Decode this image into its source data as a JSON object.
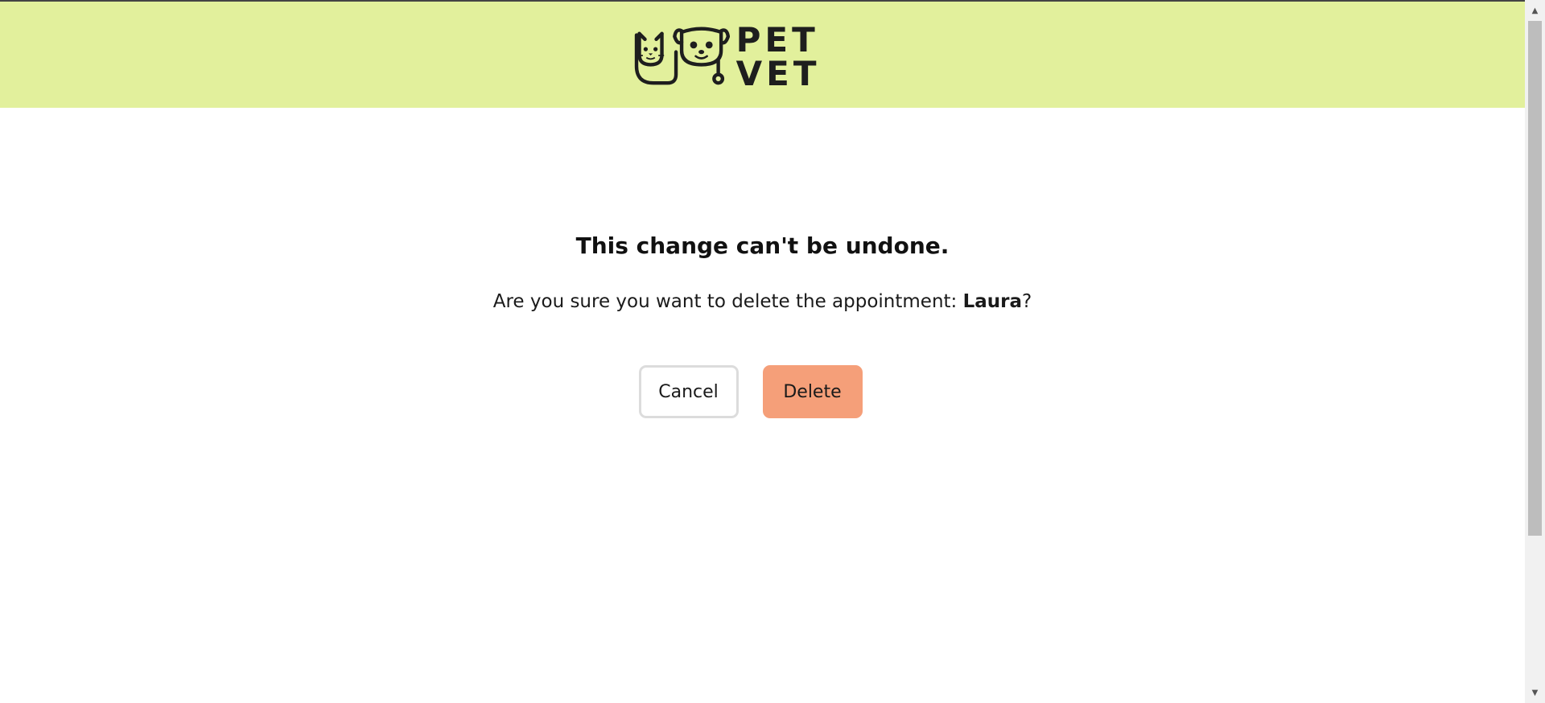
{
  "header": {
    "brand_name": "PET VET",
    "logo_icon": "cat-dog-stethoscope-logo"
  },
  "dialog": {
    "title": "This change can't be undone.",
    "message_prefix": "Are you sure you want to delete the appointment: ",
    "appointment_name": "Laura",
    "message_suffix": "?",
    "cancel_label": "Cancel",
    "delete_label": "Delete"
  },
  "colors": {
    "header_bg": "#e2f09c",
    "delete_button_bg": "#f59f79",
    "cancel_button_border": "#dcdcdc",
    "text": "#111111"
  },
  "scrollbar": {
    "up_icon": "scroll-up-arrow-icon",
    "down_icon": "scroll-down-arrow-icon"
  }
}
